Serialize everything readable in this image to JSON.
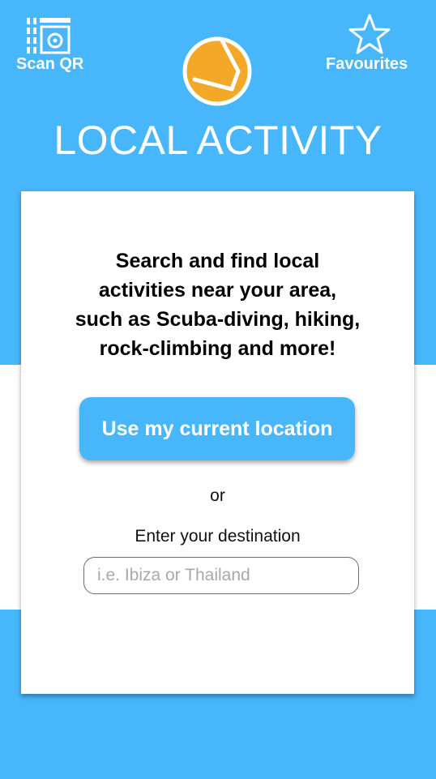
{
  "header": {
    "scan_label": "Scan QR",
    "scan_icon": "qr-scan-icon",
    "favourites_label": "Favourites",
    "favourites_icon": "star-icon",
    "logo_icon": "app-logo"
  },
  "title": "LOCAL ACTIVITY",
  "card": {
    "description_lines": [
      "Search and find local",
      "activities near your area,",
      "such as Scuba-diving, hiking,",
      "rock-climbing and more!"
    ],
    "cta_label": "Use my current location",
    "or_text": "or",
    "destination_label": "Enter your destination",
    "destination_placeholder": "i.e. Ibiza or Thailand",
    "destination_value": ""
  },
  "colors": {
    "brand_blue": "#47b6fb",
    "logo_orange": "#f3a827",
    "white": "#ffffff"
  }
}
